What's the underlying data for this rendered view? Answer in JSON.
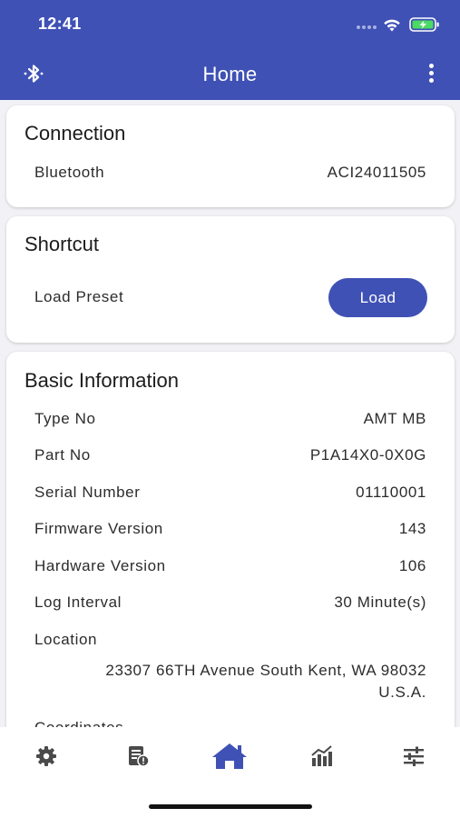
{
  "status_bar": {
    "time": "12:41"
  },
  "header": {
    "title": "Home"
  },
  "connection": {
    "title": "Connection",
    "label": "Bluetooth",
    "value": "ACI24011505"
  },
  "shortcut": {
    "title": "Shortcut",
    "label": "Load Preset",
    "button_label": "Load"
  },
  "basic_info": {
    "title": "Basic Information",
    "rows": [
      {
        "label": "Type No",
        "value": "AMT MB"
      },
      {
        "label": "Part No",
        "value": "P1A14X0-0X0G"
      },
      {
        "label": "Serial Number",
        "value": "01110001"
      },
      {
        "label": "Firmware Version",
        "value": "143"
      },
      {
        "label": "Hardware Version",
        "value": "106"
      },
      {
        "label": "Log Interval",
        "value": "30 Minute(s)"
      }
    ],
    "location_label": "Location",
    "location_line1": "23307 66TH Avenue South Kent, WA 98032",
    "location_line2": "U.S.A.",
    "coordinates_label": "Coordinates"
  },
  "bottom_nav": {
    "items": [
      {
        "icon": "settings-gear-icon",
        "active": false
      },
      {
        "icon": "device-report-icon",
        "active": false
      },
      {
        "icon": "home-icon",
        "active": true
      },
      {
        "icon": "chart-icon",
        "active": false
      },
      {
        "icon": "sliders-icon",
        "active": false
      }
    ]
  },
  "colors": {
    "primary": "#3f51b5",
    "inactive_icon": "#4a4a4a",
    "background": "#f2f2f6"
  }
}
